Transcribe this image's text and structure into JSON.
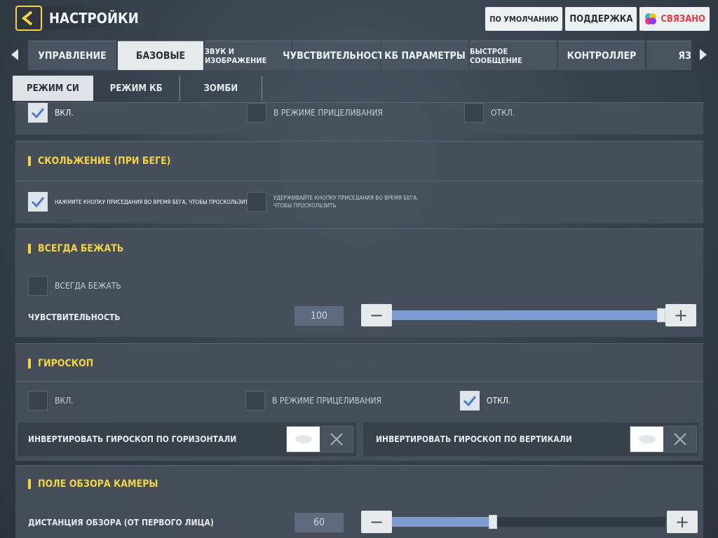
{
  "header": {
    "title": "НАСТРОЙКИ",
    "default_label": "ПО УМОЛЧАНИЮ",
    "support_label": "ПОДДЕРЖКА",
    "linked_label": "СВЯЗАНО"
  },
  "tabs": [
    "УПРАВЛЕНИЕ",
    "БАЗОВЫЕ",
    "ЗВУК И ИЗОБРАЖЕНИЕ",
    "ЧУВСТВИТЕЛЬНОСТЬ",
    "КБ ПАРАМЕТРЫ",
    "БЫСТРОЕ СООБЩЕНИЕ",
    "КОНТРОЛЛЕР",
    "ЯЗ"
  ],
  "subtabs": [
    "РЕЖИМ СИ",
    "РЕЖИМ КБ",
    "ЗОМБИ"
  ],
  "aim_options": {
    "on": "ВКЛ.",
    "ads": "В РЕЖИМЕ ПРИЦЕЛИВАНИЯ",
    "off": "ОТКЛ."
  },
  "slide": {
    "title": "СКОЛЬЖЕНИЕ (ПРИ БЕГЕ)",
    "opt1": "НАЖМИТЕ КНОПКУ ПРИСЕДАНИЯ ВО ВРЕМЯ БЕГА, ЧТОБЫ ПРОСКОЛЬЗИТЬ",
    "opt2": "УДЕРЖИВАЙТЕ КНОПКУ ПРИСЕДАНИЯ ВО ВРЕМЯ БЕГА, ЧТОБЫ ПРОСКОЛЬЗИТЬ"
  },
  "always_run": {
    "title": "ВСЕГДА БЕЖАТЬ",
    "option": "ВСЕГДА БЕЖАТЬ",
    "sens_label": "ЧУВСТВИТЕЛЬНОСТЬ",
    "sens_value": "100",
    "sens_fraction": 1.0
  },
  "gyro": {
    "title": "ГИРОСКОП",
    "on": "ВКЛ.",
    "ads": "В РЕЖИМЕ ПРИЦЕЛИВАНИЯ",
    "off": "ОТКЛ.",
    "invert_h": "ИНВЕРТИРОВАТЬ ГИРОСКОП ПО ГОРИЗОНТАЛИ",
    "invert_v": "ИНВЕРТИРОВАТЬ ГИРОСКОП ПО ВЕРТИКАЛИ"
  },
  "fov": {
    "title": "ПОЛЕ ОБЗОРА КАМЕРЫ",
    "label": "ДИСТАНЦИЯ ОБЗОРА (ОТ ПЕРВОГО ЛИЦА)",
    "value": "60",
    "fraction": 0.37
  },
  "colors": {
    "accent": "#f3d347",
    "slider_fill": "#7e9cd2"
  }
}
